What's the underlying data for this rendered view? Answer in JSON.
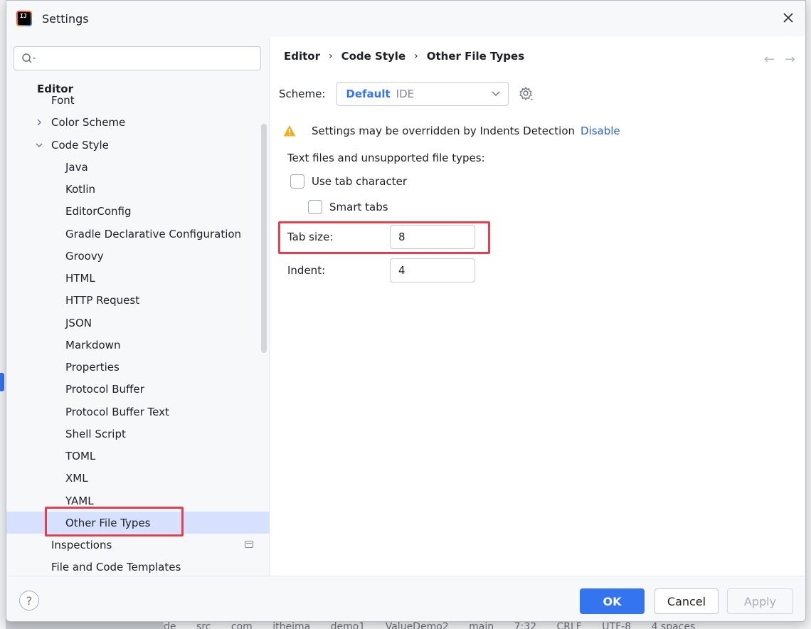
{
  "window": {
    "title": "Settings",
    "app_icon_text": "IJ"
  },
  "search": {
    "placeholder": "",
    "value": ""
  },
  "tree": {
    "section": "Editor",
    "items": [
      {
        "label": "Font"
      },
      {
        "label": "Color Scheme"
      },
      {
        "label": "Code Style"
      },
      {
        "label": "Java"
      },
      {
        "label": "Kotlin"
      },
      {
        "label": "EditorConfig"
      },
      {
        "label": "Gradle Declarative Configuration"
      },
      {
        "label": "Groovy"
      },
      {
        "label": "HTML"
      },
      {
        "label": "HTTP Request"
      },
      {
        "label": "JSON"
      },
      {
        "label": "Markdown"
      },
      {
        "label": "Properties"
      },
      {
        "label": "Protocol Buffer"
      },
      {
        "label": "Protocol Buffer Text"
      },
      {
        "label": "Shell Script"
      },
      {
        "label": "TOML"
      },
      {
        "label": "XML"
      },
      {
        "label": "YAML"
      },
      {
        "label": "Other File Types"
      },
      {
        "label": "Inspections"
      },
      {
        "label": "File and Code Templates"
      }
    ],
    "selected": "Other File Types"
  },
  "breadcrumb": {
    "items": [
      "Editor",
      "Code Style",
      "Other File Types"
    ]
  },
  "scheme": {
    "label": "Scheme:",
    "name": "Default",
    "kind": "IDE"
  },
  "warning": {
    "text": "Settings may be overridden by Indents Detection",
    "link": "Disable"
  },
  "options": {
    "section_title": "Text files and unsupported file types:",
    "use_tab_label": "Use tab character",
    "use_tab_checked": false,
    "smart_tabs_label": "Smart tabs",
    "smart_tabs_checked": false,
    "tab_size_label": "Tab size:",
    "tab_size_value": "8",
    "indent_label": "Indent:",
    "indent_value": "4"
  },
  "footer": {
    "help": "?",
    "ok": "OK",
    "cancel": "Cancel",
    "apply": "Apply"
  },
  "statusbar": {
    "items": [
      "de",
      "src",
      "com",
      "itheima",
      "demo1",
      "ValueDemo2",
      "main",
      "7:32",
      "CRLF",
      "UTF-8",
      "4 spaces"
    ]
  },
  "colors": {
    "accent": "#3574f0",
    "highlight": "#e53e4e",
    "selection": "#d5e1ff",
    "link": "#2e61d4",
    "warning": "#f2b01e"
  }
}
